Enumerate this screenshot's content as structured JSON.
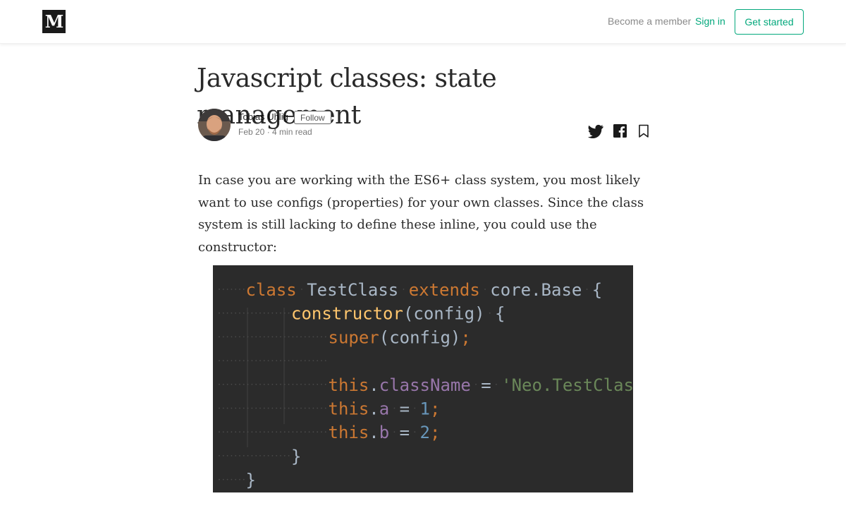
{
  "header": {
    "logo": "M",
    "become_member": "Become a member",
    "sign_in": "Sign in",
    "get_started": "Get started"
  },
  "article": {
    "title": "Javascript classes: state management",
    "author": "Tobias Uhlig",
    "follow": "Follow",
    "meta": "Feb 20 · 4 min read",
    "paragraph": "In case you are working with the ES6+ class system, you most likely want to use configs (properties) for your own classes. Since the class system is still lacking to define these inline, you could use the constructor:"
  },
  "code": {
    "lines": [
      [
        {
          "t": "class",
          "c": "kw"
        },
        {
          "t": "TestClass",
          "c": "plain"
        },
        {
          "t": "extends",
          "c": "kw"
        },
        {
          "t": "core.Base",
          "c": "plain"
        },
        {
          "t": "{",
          "c": "plain"
        }
      ],
      [
        {
          "t": "constructor",
          "c": "fn"
        },
        {
          "t": "(config)",
          "c": "plain"
        },
        {
          "t": "{",
          "c": "plain"
        }
      ],
      [
        {
          "t": "super",
          "c": "kw"
        },
        {
          "t": "(config)",
          "c": "plain"
        },
        {
          "t": ";",
          "c": "kw"
        }
      ],
      [],
      [
        {
          "t": "this",
          "c": "kw"
        },
        {
          "t": ".",
          "c": "plain"
        },
        {
          "t": "className",
          "c": "prop"
        },
        {
          "t": "=",
          "c": "plain"
        },
        {
          "t": "'Neo.TestClass'",
          "c": "str"
        },
        {
          "t": ";",
          "c": "kw"
        }
      ],
      [
        {
          "t": "this",
          "c": "kw"
        },
        {
          "t": ".",
          "c": "plain"
        },
        {
          "t": "a",
          "c": "prop"
        },
        {
          "t": "=",
          "c": "plain"
        },
        {
          "t": "1",
          "c": "num"
        },
        {
          "t": ";",
          "c": "kw"
        }
      ],
      [
        {
          "t": "this",
          "c": "kw"
        },
        {
          "t": ".",
          "c": "plain"
        },
        {
          "t": "b",
          "c": "prop"
        },
        {
          "t": "=",
          "c": "plain"
        },
        {
          "t": "2",
          "c": "num"
        },
        {
          "t": ";",
          "c": "kw"
        }
      ],
      [
        {
          "t": "}",
          "c": "plain"
        }
      ],
      [
        {
          "t": "}",
          "c": "plain"
        }
      ]
    ],
    "indent": [
      1,
      2,
      3,
      3,
      3,
      3,
      3,
      2,
      1
    ],
    "colors": {
      "background": "#2b2b2b",
      "kw": "#cc7832",
      "fn": "#ffc66d",
      "plain": "#a9b7c6",
      "prop": "#9876aa",
      "str": "#6a8759",
      "num": "#6897bb"
    }
  },
  "colors": {
    "accent": "#03a87c",
    "text": "rgba(0,0,0,0.84)",
    "muted": "rgba(0,0,0,0.54)"
  },
  "icons": {
    "twitter": "twitter-icon",
    "facebook": "facebook-icon",
    "bookmark": "bookmark-icon"
  }
}
